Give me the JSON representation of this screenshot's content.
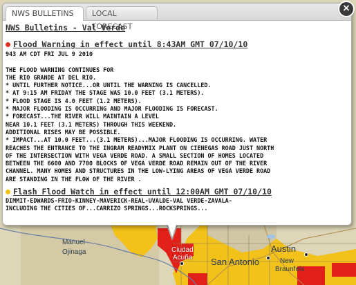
{
  "tabs": [
    {
      "label": "NWS BULLETINS",
      "active": true
    },
    {
      "label": "LOCAL FORECAST",
      "active": false
    }
  ],
  "close_label": "×",
  "heading": "NWS Bulletins - Val Verde",
  "bulletins": [
    {
      "title": "Flood Warning in effect until 8:43AM GMT 07/10/10",
      "dot_color": "#e03020",
      "text": "943 AM CDT FRI JUL 9 2010\n\nTHE FLOOD WARNING CONTINUES FOR\nTHE RIO GRANDE AT DEL RIO.\n* UNTIL FURTHER NOTICE...OR UNTIL THE WARNING IS CANCELLED.\n* AT 9:15 AM FRIDAY THE STAGE WAS 10.0 FEET (3.1 METERS).\n* FLOOD STAGE IS 4.0 FEET (1.2 METERS).\n* MAJOR FLOODING IS OCCURRING AND MAJOR FLOODING IS FORECAST.\n* FORECAST...THE RIVER WILL MAINTAIN A LEVEL\nNEAR 10.1 FEET (3.1 METERS) THROUGH THIS WEEKEND.\nADDITIONAL RISES MAY BE POSSIBLE.\n* IMPACT...AT 10.0 FEET...(3.1 METERS)...MAJOR FLOODING IS OCCURRING. WATER\nREACHES THE ENTRANCE TO THE INGRAM READYMIX PLANT ON CIENEGAS ROAD JUST NORTH\nOF THE INTERSECTION WITH VEGA VERDE ROAD. A SMALL SECTION OF HOMES LOCATED\nBETWEEN THE 6600 AND 7700 BLOCKS OF VEGA VERDE ROAD REMAIN OUT OF THE RIVER\nCHANNEL. MANY HOMES AND STRUCTURES IN THE LOW-LYING AREAS OF VEGA VERDE ROAD\nARE STANDING IN THE FLOW OF THE RIVER ."
    },
    {
      "title": "Flash Flood Watch in effect until 12:00AM GMT 07/10/10",
      "dot_color": "#f2c21a",
      "text": "DIMMIT-EDWARDS-FRIO-KINNEY-MAVERICK-REAL-UVALDE-VAL VERDE-ZAVALA-\nINCLUDING THE CITIES OF...CARRIZO SPRINGS...ROCKSPRINGS..."
    }
  ],
  "map": {
    "labels": {
      "manuel": "Manuel",
      "ojinaga": "Ojinaga",
      "ciudad": "Ciudad",
      "acuna": "Acuña",
      "austin": "Austin",
      "san_antonio": "San Antonio",
      "new": "New",
      "braunfels": "Braunfels"
    },
    "colors": {
      "land": "#ddd6b8",
      "watch": "#f2c21a",
      "warning": "#e2201a",
      "water": "#9ec3e6"
    }
  }
}
